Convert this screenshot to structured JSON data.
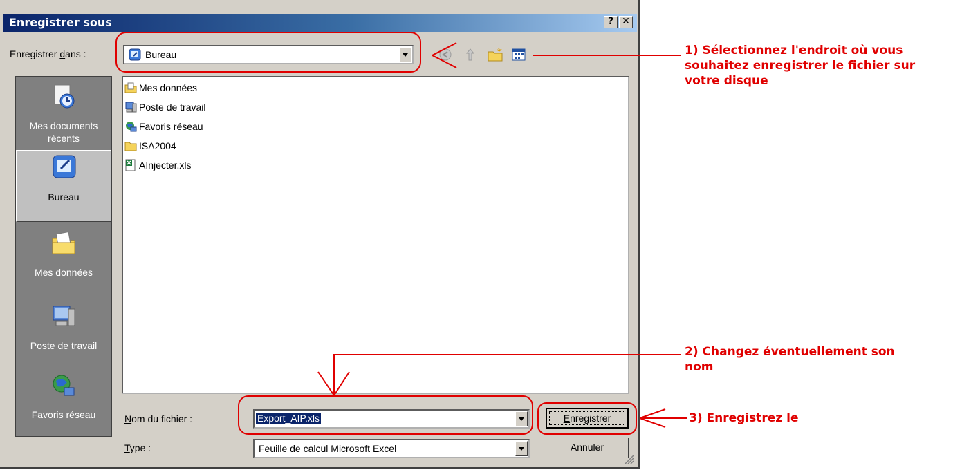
{
  "dialog": {
    "title": "Enregistrer sous",
    "help_label": "?",
    "close_label": "✕",
    "save_in_label_pre": "Enregistrer ",
    "save_in_label_u": "d",
    "save_in_label_post": "ans :",
    "location_value": "Bureau",
    "places": [
      {
        "label_line1": "Mes documents",
        "label_line2": "récents"
      },
      {
        "label_line1": "Bureau",
        "label_line2": ""
      },
      {
        "label_line1": "Mes données",
        "label_line2": ""
      },
      {
        "label_line1": "Poste de travail",
        "label_line2": ""
      },
      {
        "label_line1": "Favoris réseau",
        "label_line2": ""
      }
    ],
    "files": [
      {
        "name": "Mes données",
        "icon": "documents-folder-icon"
      },
      {
        "name": "Poste de travail",
        "icon": "computer-icon"
      },
      {
        "name": "Favoris réseau",
        "icon": "network-icon"
      },
      {
        "name": "ISA2004",
        "icon": "folder-icon"
      },
      {
        "name": "AInjecter.xls",
        "icon": "excel-file-icon"
      }
    ],
    "filename_label_u": "N",
    "filename_label_post": "om du fichier :",
    "filename_value": "Export_AIP.xls",
    "type_label_u": "T",
    "type_label_post": "ype :",
    "type_value": "Feuille de calcul Microsoft Excel",
    "save_button_u": "E",
    "save_button_post": "nregistrer",
    "cancel_button": "Annuler"
  },
  "annotations": {
    "note1_line1": "1) Sélectionnez l'endroit où vous",
    "note1_line2": "souhaitez enregistrer le fichier sur",
    "note1_line3": "votre disque",
    "note2_line1": "2) Changez éventuellement son",
    "note2_line2": "nom",
    "note3": "3) Enregistrez le",
    "color": "#e00000"
  }
}
